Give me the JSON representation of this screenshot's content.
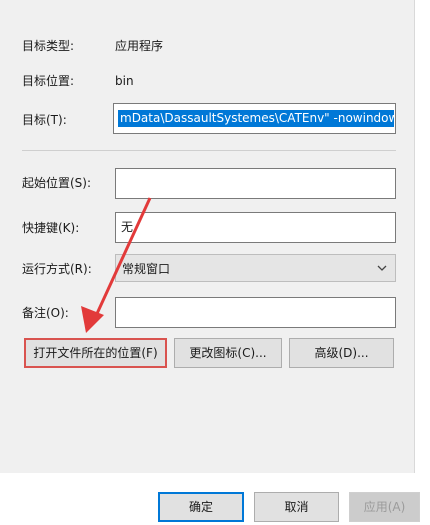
{
  "properties": {
    "target_type_label": "目标类型:",
    "target_type_value": "应用程序",
    "target_location_label": "目标位置:",
    "target_location_value": "bin",
    "target_label": "目标(T):",
    "target_value": "mData\\DassaultSystemes\\CATEnv\" -nowindow",
    "start_in_label": "起始位置(S):",
    "start_in_value": "",
    "shortcut_key_label": "快捷键(K):",
    "shortcut_key_value": "无",
    "run_label": "运行方式(R):",
    "run_value": "常规窗口",
    "comment_label": "备注(O):",
    "comment_value": ""
  },
  "buttons": {
    "open_location": "打开文件所在的位置(F)",
    "change_icon": "更改图标(C)...",
    "advanced": "高级(D)..."
  },
  "footer": {
    "ok": "确定",
    "cancel": "取消",
    "apply": "应用(A)"
  },
  "colors": {
    "selection": "#0078d7",
    "highlight_annotation": "#d9534f"
  }
}
